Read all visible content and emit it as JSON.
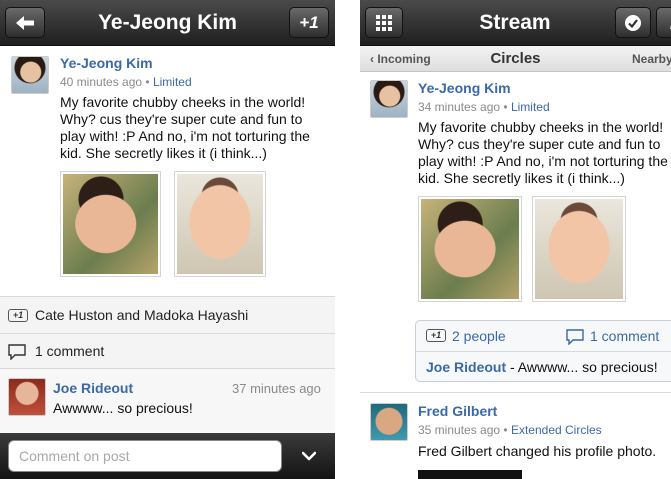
{
  "left": {
    "header": {
      "title": "Ye-Jeong Kim",
      "plus_one": "+1"
    },
    "post": {
      "author": "Ye-Jeong Kim",
      "time": "40 minutes ago",
      "sep": "•",
      "visibility": "Limited",
      "text": "My favorite chubby cheeks in the world! Why? cus they're super cute and fun to play with! :P And no, i'm not torturing the kid. She secretly likes it (i think...)"
    },
    "plus_ones": {
      "badge": "+1",
      "names": "Cate Huston and Madoka Hayashi"
    },
    "comments": {
      "count": "1 comment"
    },
    "comment": {
      "author": "Joe Rideout",
      "time": "37 minutes ago",
      "text": "Awwww... so precious!"
    },
    "composer": {
      "placeholder": "Comment on post"
    }
  },
  "right": {
    "header": {
      "title": "Stream"
    },
    "subnav": {
      "left": "‹ Incoming",
      "center": "Circles",
      "right": "Nearby"
    },
    "post": {
      "author": "Ye-Jeong Kim",
      "time": "34 minutes ago",
      "sep": "•",
      "visibility": "Limited",
      "text": "My favorite chubby cheeks in the world! Why? cus they're super cute and fun to play with! :P And no, i'm not torturing the kid. She secretly likes it (i think...)"
    },
    "card": {
      "plus_badge": "+1",
      "people": "2 people",
      "comments": "1 comment",
      "comment_author": "Joe Rideout",
      "comment_text": " - Awwww... so precious!"
    },
    "post2": {
      "author": "Fred Gilbert",
      "time": "35 minutes ago",
      "sep": "•",
      "visibility": "Extended Circles",
      "text": "Fred Gilbert changed his profile photo."
    }
  },
  "icons": [
    "back-arrow-icon",
    "plus-one-icon",
    "grid-icon",
    "check-icon",
    "pencil-icon",
    "comment-bubble-icon",
    "chevron-down-icon"
  ],
  "colors": {
    "link": "#3b69a8",
    "header_dark": "#2a2a2a",
    "meta_gray": "#8a8a8a"
  }
}
